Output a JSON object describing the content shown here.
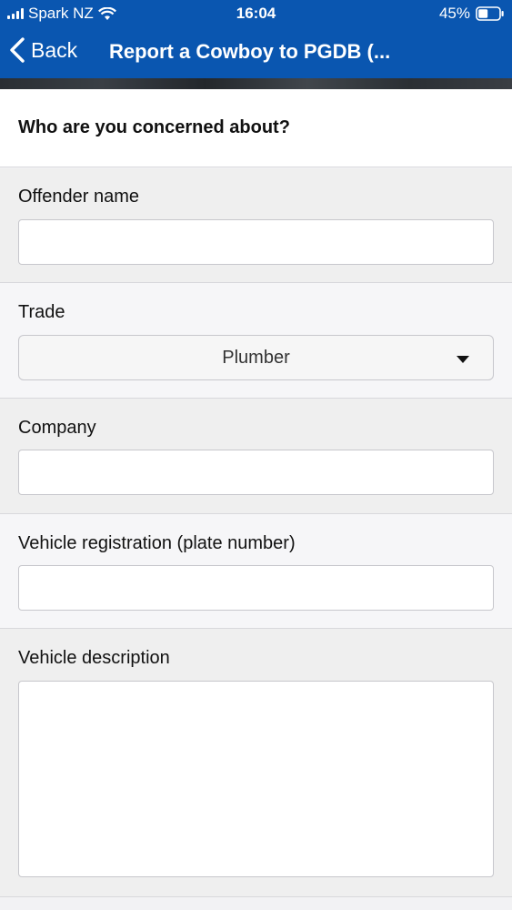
{
  "status_bar": {
    "carrier": "Spark NZ",
    "time": "16:04",
    "battery": "45%"
  },
  "nav": {
    "back_label": "Back",
    "title": "Report a Cowboy to PGDB (..."
  },
  "section": {
    "heading": "Who are you concerned about?"
  },
  "fields": {
    "offender_name": {
      "label": "Offender name",
      "value": ""
    },
    "trade": {
      "label": "Trade",
      "selected": "Plumber"
    },
    "company": {
      "label": "Company",
      "value": ""
    },
    "vehicle_registration": {
      "label": "Vehicle registration (plate number)",
      "value": ""
    },
    "vehicle_description": {
      "label": "Vehicle description",
      "value": ""
    }
  },
  "colors": {
    "nav_bg": "#0a56b0"
  }
}
